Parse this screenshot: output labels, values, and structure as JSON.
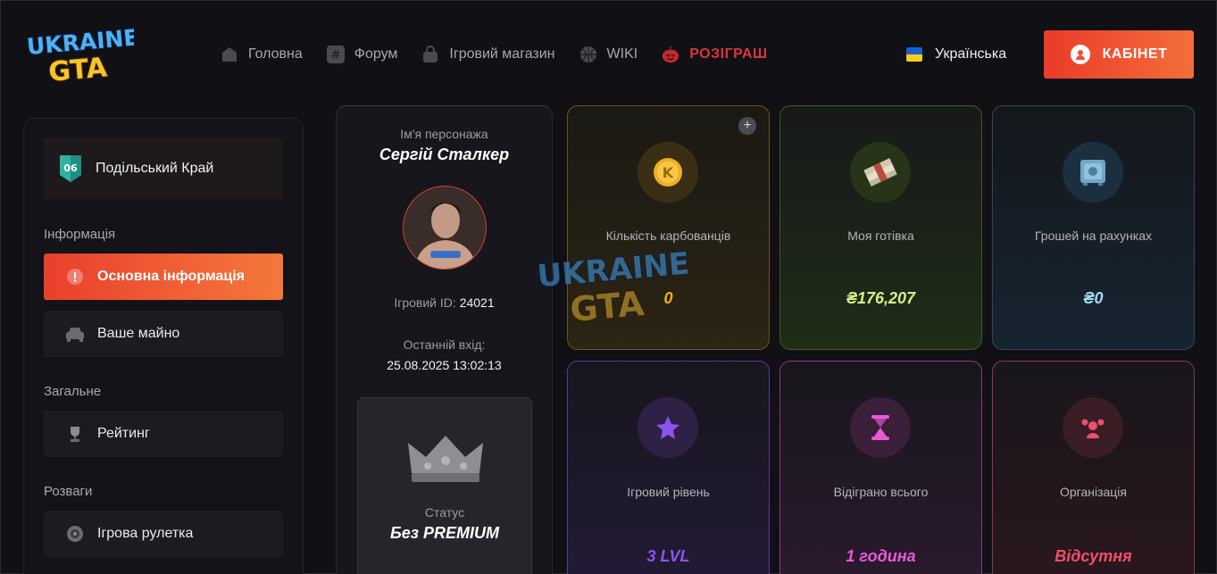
{
  "header": {
    "logo_text_line1": "UKRAINE",
    "logo_text_line2": "GTA",
    "nav": [
      {
        "label": "Головна",
        "icon": "home-icon"
      },
      {
        "label": "Форум",
        "icon": "hash-icon"
      },
      {
        "label": "Ігровий магазин",
        "icon": "shopping-bag-icon"
      },
      {
        "label": "WIKI",
        "icon": "globe-icon"
      },
      {
        "label": "РОЗІГРАШ",
        "icon": "pumpkin-icon"
      }
    ],
    "language": "Українська",
    "cabinet_button": "КАБІНЕТ"
  },
  "sidebar": {
    "server": "Подільський Край",
    "server_badge": "06",
    "sections": {
      "info": "Інформація",
      "general": "Загальне",
      "fun": "Розваги"
    },
    "items": {
      "main_info": "Основна інформація",
      "property": "Ваше майно",
      "rating": "Рейтинг",
      "roulette": "Ігрова рулетка"
    }
  },
  "profile": {
    "name_label": "Ім'я персонажа",
    "name": "Сергій Сталкер",
    "id_label": "Ігровий ID:",
    "id_value": "24021",
    "last_login_label": "Останній вхід:",
    "last_login_value": "25.08.2025 13:02:13",
    "status_label": "Статус",
    "status_value": "Без PREMIUM"
  },
  "stats": [
    {
      "label": "Кількість карбованців",
      "value": "0",
      "icon": "karbovanets-coin-icon",
      "color": "#f2b01e"
    },
    {
      "label": "Моя готівка",
      "value": "₴176,207",
      "icon": "cash-stack-icon",
      "color": "#d6f08a"
    },
    {
      "label": "Грошей на рахунках",
      "value": "₴0",
      "icon": "bank-safe-icon",
      "color": "#9fdcf5"
    },
    {
      "label": "Ігровий рівень",
      "value": "3 LVL",
      "icon": "star-level-icon",
      "color": "#8b54f0"
    },
    {
      "label": "Відіграно всього",
      "value": "1 година",
      "icon": "hourglass-icon",
      "color": "#e85ad8"
    },
    {
      "label": "Організація",
      "value": "Відсутня",
      "icon": "organization-icon",
      "color": "#ee4f6d"
    }
  ],
  "colors": {
    "accent_start": "#ea3b2a",
    "accent_end": "#f36e3a",
    "promo": "#d9363e"
  }
}
